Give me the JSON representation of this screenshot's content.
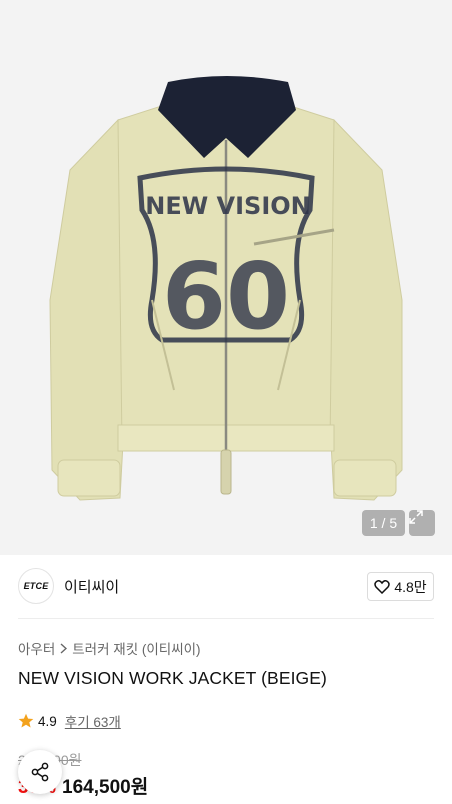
{
  "gallery": {
    "counter": "1 / 5",
    "print_text": "NEW VISION",
    "print_number": "60"
  },
  "brand": {
    "logo_text": "ETCE",
    "name": "이티씨이",
    "likes": "4.8만"
  },
  "breadcrumb": {
    "category": "아우터",
    "subcategory": "트러커 재킷 (이티씨이)"
  },
  "product": {
    "title": "NEW VISION WORK JACKET (BEIGE)"
  },
  "rating": {
    "score": "4.9",
    "reviews": "후기 63개"
  },
  "price": {
    "original": "235,000원",
    "discount": "30%",
    "current": "164,500원"
  },
  "colors": {
    "jacket": "#e4e2b8",
    "collar": "#1c2234",
    "print": "#2c3248",
    "discount": "#f31110"
  },
  "icons": {
    "expand": "expand-icon",
    "heart": "heart-icon",
    "chevron": "chevron-right-icon",
    "star": "star-icon",
    "share": "share-icon"
  }
}
